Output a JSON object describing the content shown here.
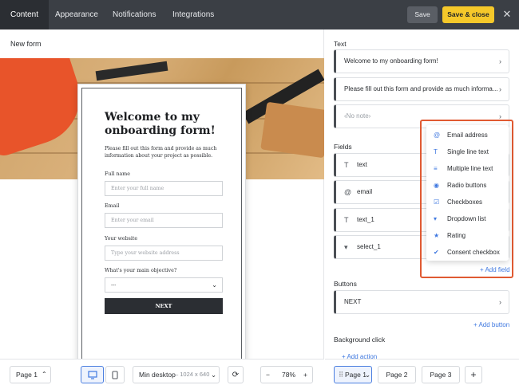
{
  "topbar": {
    "tabs": [
      "Content",
      "Appearance",
      "Notifications",
      "Integrations"
    ],
    "save_label": "Save",
    "save_close_label": "Save & close",
    "close_glyph": "✕"
  },
  "canvas": {
    "form_name": "New form",
    "form": {
      "title": "Welcome to my onboarding form!",
      "description": "Please fill out this form and provide as much information about your project as possible.",
      "fields": [
        {
          "label": "Full name",
          "placeholder": "Enter your full name"
        },
        {
          "label": "Email",
          "placeholder": "Enter your email"
        },
        {
          "label": "Your website",
          "placeholder": "Type your website address"
        },
        {
          "label": "What's your main objective?",
          "value": "---"
        }
      ],
      "next_label": "NEXT"
    }
  },
  "bottombar": {
    "page_select": "Page 1",
    "viewport_label": "Min desktop",
    "viewport_size": " – 1024 x 640",
    "zoom": "78%",
    "zoom_minus": "−",
    "zoom_plus": "+"
  },
  "panel": {
    "text_title": "Text",
    "text_items": [
      "Welcome to my onboarding form!",
      "Please fill out this form and provide as much informa...",
      "‹No note›"
    ],
    "fields_title": "Fields",
    "field_items": [
      {
        "icon": "T",
        "label": "text"
      },
      {
        "icon": "@",
        "label": "email"
      },
      {
        "icon": "T",
        "label": "text_1"
      },
      {
        "icon": "▾",
        "label": "select_1"
      }
    ],
    "add_field": "+ Add field",
    "buttons_title": "Buttons",
    "button_items": [
      "NEXT"
    ],
    "add_button": "+ Add button",
    "background_title": "Background click",
    "add_action": "+ Add action"
  },
  "dropdown": {
    "items": [
      {
        "icon": "@",
        "label": "Email address"
      },
      {
        "icon": "T",
        "label": "Single line text"
      },
      {
        "icon": "≡",
        "label": "Multiple line text"
      },
      {
        "icon": "◉",
        "label": "Radio buttons"
      },
      {
        "icon": "☑",
        "label": "Checkboxes"
      },
      {
        "icon": "▾",
        "label": "Dropdown list"
      },
      {
        "icon": "★",
        "label": "Rating"
      },
      {
        "icon": "✔",
        "label": "Consent checkbox"
      }
    ]
  },
  "pages": {
    "tabs": [
      "Page 1",
      "Page 2",
      "Page 3"
    ],
    "add": "+"
  },
  "colors": {
    "accent": "#f5c82a",
    "link": "#3f78e0",
    "highlight": "#e05a32",
    "topbar": "#3b3f45"
  }
}
